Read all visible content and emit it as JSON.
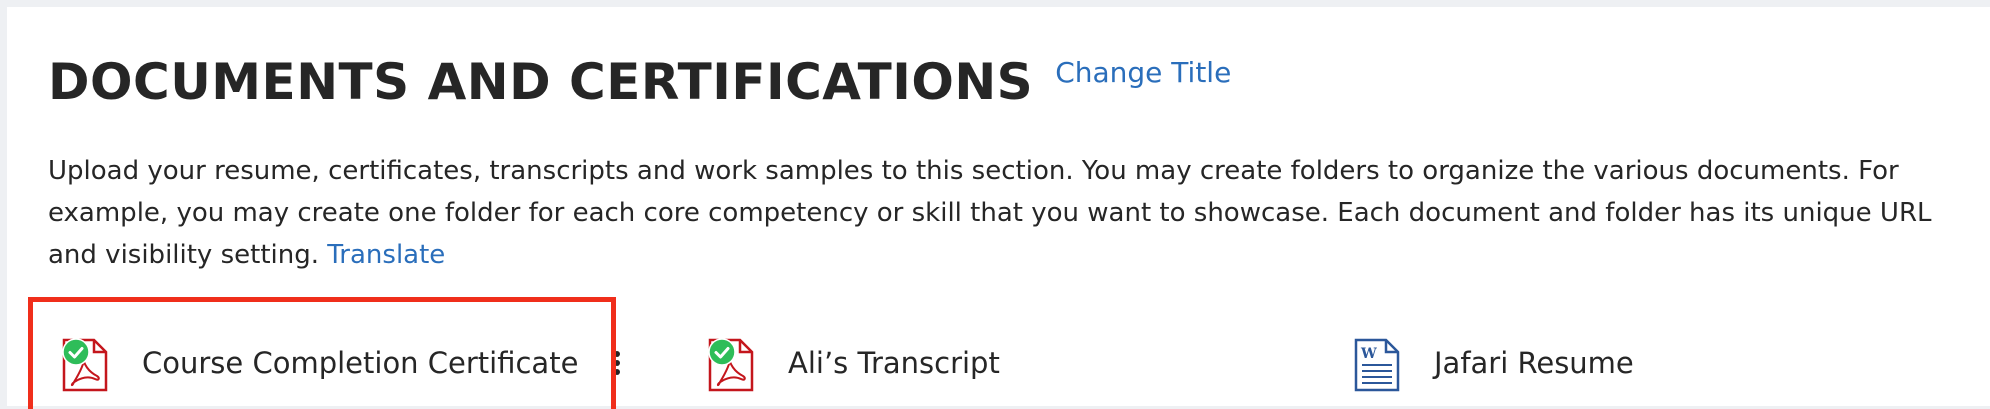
{
  "section": {
    "title": "DOCUMENTS AND CERTIFICATIONS",
    "change_title_link": "Change Title",
    "description": "Upload your resume, certificates, transcripts and work samples to this section. You may create folders to organize the various documents. For example, you may create one folder for each core competency or skill that you want to showcase. Each document and folder has its unique URL and visibility setting.",
    "translate_link": "Translate"
  },
  "documents": [
    {
      "name": "Course Completion Certificate",
      "type_icon": "pdf-icon",
      "verified": true,
      "selected": true
    },
    {
      "name": "Ali’s Transcript",
      "type_icon": "pdf-icon",
      "verified": true,
      "selected": false
    },
    {
      "name": "Jafari Resume",
      "type_icon": "word-doc-icon",
      "verified": false,
      "selected": false
    }
  ],
  "colors": {
    "link": "#2a6ebb",
    "pdf_red": "#c4161c",
    "word_blue": "#2b579a",
    "check_green": "#2ebd59",
    "highlight": "#f02e1b"
  }
}
